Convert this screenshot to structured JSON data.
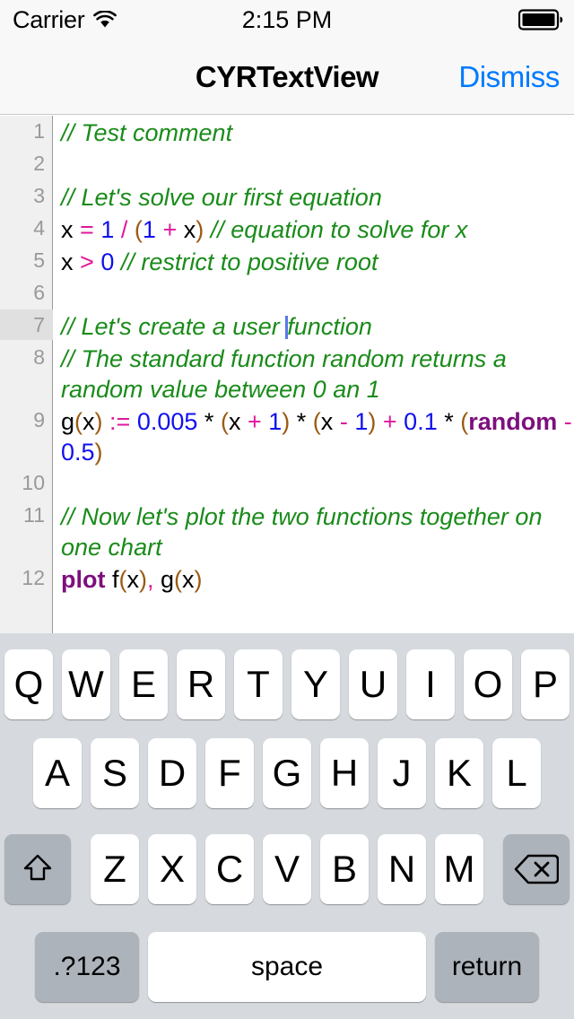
{
  "statusbar": {
    "carrier": "Carrier",
    "wifi_icon": "wifi-icon",
    "time": "2:15 PM",
    "battery_icon": "battery-full-icon"
  },
  "navbar": {
    "title": "CYRTextView",
    "action_label": "Dismiss",
    "action_color": "#007aff"
  },
  "editor": {
    "current_line": 7,
    "colors": {
      "comment": "#1a8b1a",
      "number": "#1111ee",
      "operator": "#e0189a",
      "paren": "#9c5a12",
      "keyword": "#7d0f7d",
      "plain": "#000000",
      "caret": "#5a78e8",
      "gutter_bg": "#f0f0f0",
      "gutter_text": "#999999",
      "background": "#ffffff"
    },
    "lines": [
      {
        "number": "1",
        "tokens": [
          {
            "t": "// Test comment",
            "c": "comment"
          }
        ]
      },
      {
        "number": "2",
        "tokens": []
      },
      {
        "number": "3",
        "tokens": [
          {
            "t": "// Let's solve our first equation",
            "c": "comment"
          }
        ]
      },
      {
        "number": "4",
        "tokens": [
          {
            "t": "x ",
            "c": "plain"
          },
          {
            "t": "=",
            "c": "op"
          },
          {
            "t": " ",
            "c": "plain"
          },
          {
            "t": "1",
            "c": "num"
          },
          {
            "t": " ",
            "c": "plain"
          },
          {
            "t": "/",
            "c": "op"
          },
          {
            "t": " ",
            "c": "plain"
          },
          {
            "t": "(",
            "c": "paren"
          },
          {
            "t": "1",
            "c": "num"
          },
          {
            "t": " ",
            "c": "plain"
          },
          {
            "t": "+",
            "c": "op"
          },
          {
            "t": " x",
            "c": "plain"
          },
          {
            "t": ")",
            "c": "paren"
          },
          {
            "t": " ",
            "c": "plain"
          },
          {
            "t": "// equation to solve for x",
            "c": "comment"
          }
        ]
      },
      {
        "number": "5",
        "tokens": [
          {
            "t": "x ",
            "c": "plain"
          },
          {
            "t": ">",
            "c": "op"
          },
          {
            "t": " ",
            "c": "plain"
          },
          {
            "t": "0",
            "c": "num"
          },
          {
            "t": " ",
            "c": "plain"
          },
          {
            "t": "// restrict to positive root",
            "c": "comment"
          }
        ]
      },
      {
        "number": "6",
        "tokens": []
      },
      {
        "number": "7",
        "tokens": [
          {
            "t": "// Let's create a user ",
            "c": "comment"
          },
          {
            "t": "",
            "c": "caret"
          },
          {
            "t": "function",
            "c": "comment"
          }
        ]
      },
      {
        "number": "8",
        "tokens": [
          {
            "t": "// The standard function random returns a random value between 0 an 1",
            "c": "comment"
          }
        ]
      },
      {
        "number": "9",
        "tokens": [
          {
            "t": "g",
            "c": "plain"
          },
          {
            "t": "(",
            "c": "paren"
          },
          {
            "t": "x",
            "c": "plain"
          },
          {
            "t": ")",
            "c": "paren"
          },
          {
            "t": " ",
            "c": "plain"
          },
          {
            "t": ":=",
            "c": "op"
          },
          {
            "t": " ",
            "c": "plain"
          },
          {
            "t": "0.005",
            "c": "num"
          },
          {
            "t": " * ",
            "c": "plain"
          },
          {
            "t": "(",
            "c": "paren"
          },
          {
            "t": "x ",
            "c": "plain"
          },
          {
            "t": "+",
            "c": "op"
          },
          {
            "t": " ",
            "c": "plain"
          },
          {
            "t": "1",
            "c": "num"
          },
          {
            "t": ")",
            "c": "paren"
          },
          {
            "t": " * ",
            "c": "plain"
          },
          {
            "t": "(",
            "c": "paren"
          },
          {
            "t": "x ",
            "c": "plain"
          },
          {
            "t": "-",
            "c": "op"
          },
          {
            "t": " ",
            "c": "plain"
          },
          {
            "t": "1",
            "c": "num"
          },
          {
            "t": ")",
            "c": "paren"
          },
          {
            "t": " ",
            "c": "plain"
          },
          {
            "t": "+",
            "c": "op"
          },
          {
            "t": " ",
            "c": "plain"
          },
          {
            "t": "0.1",
            "c": "num"
          },
          {
            "t": " * ",
            "c": "plain"
          },
          {
            "t": "(",
            "c": "paren"
          },
          {
            "t": "random",
            "c": "kw"
          },
          {
            "t": " ",
            "c": "plain"
          },
          {
            "t": "-",
            "c": "op"
          },
          {
            "t": " ",
            "c": "plain"
          },
          {
            "t": "0.5",
            "c": "num"
          },
          {
            "t": ")",
            "c": "paren"
          }
        ]
      },
      {
        "number": "10",
        "tokens": []
      },
      {
        "number": "11",
        "tokens": [
          {
            "t": "// Now let's plot the two functions together on one chart",
            "c": "comment"
          }
        ]
      },
      {
        "number": "12",
        "tokens": [
          {
            "t": "plot",
            "c": "kw"
          },
          {
            "t": " f",
            "c": "plain"
          },
          {
            "t": "(",
            "c": "paren"
          },
          {
            "t": "x",
            "c": "plain"
          },
          {
            "t": ")",
            "c": "paren"
          },
          {
            "t": ",",
            "c": "op"
          },
          {
            "t": " g",
            "c": "plain"
          },
          {
            "t": "(",
            "c": "paren"
          },
          {
            "t": "x",
            "c": "plain"
          },
          {
            "t": ")",
            "c": "paren"
          }
        ]
      }
    ]
  },
  "keyboard": {
    "row1": [
      "Q",
      "W",
      "E",
      "R",
      "T",
      "Y",
      "U",
      "I",
      "O",
      "P"
    ],
    "row2": [
      "A",
      "S",
      "D",
      "F",
      "G",
      "H",
      "J",
      "K",
      "L"
    ],
    "row3_letters": [
      "Z",
      "X",
      "C",
      "V",
      "B",
      "N",
      "M"
    ],
    "shift_icon": "shift-arrow-icon",
    "delete_icon": "backspace-icon",
    "numeric_label": ".?123",
    "space_label": "space",
    "return_label": "return",
    "bg_color": "#d6dade",
    "key_color": "#ffffff",
    "mod_key_color": "#adb3bb"
  }
}
